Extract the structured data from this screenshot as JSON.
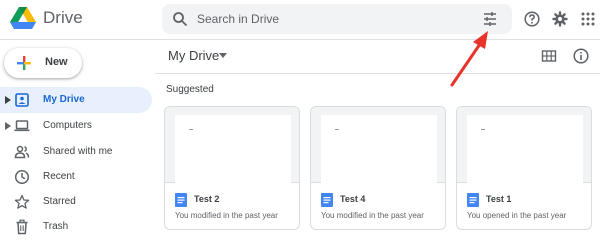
{
  "app": {
    "title": "Drive"
  },
  "search": {
    "placeholder": "Search in Drive"
  },
  "sidebar": {
    "new_label": "New",
    "items": [
      {
        "label": "My Drive",
        "active": true
      },
      {
        "label": "Computers"
      },
      {
        "label": "Shared with me"
      },
      {
        "label": "Recent"
      },
      {
        "label": "Starred"
      },
      {
        "label": "Trash"
      }
    ]
  },
  "main": {
    "title": "My Drive",
    "section_title": "Suggested",
    "cards": [
      {
        "name": "Test 2",
        "activity": "You modified in the past year"
      },
      {
        "name": "Test 4",
        "activity": "You modified in the past year"
      },
      {
        "name": "Test 1",
        "activity": "You opened in the past year"
      }
    ]
  },
  "colors": {
    "accent": "#1a73e8",
    "active_bg": "#e8f0fe",
    "annotation_arrow": "#e8322a",
    "doc_blue": "#4285f4"
  },
  "icons": [
    "drive-logo",
    "search-icon",
    "tune-icon",
    "help-icon",
    "gear-icon",
    "apps-grid-icon",
    "plus-icon",
    "my-drive-icon",
    "computers-icon",
    "shared-icon",
    "recent-icon",
    "star-icon",
    "trash-icon",
    "grid-view-icon",
    "info-icon",
    "doc-icon"
  ]
}
